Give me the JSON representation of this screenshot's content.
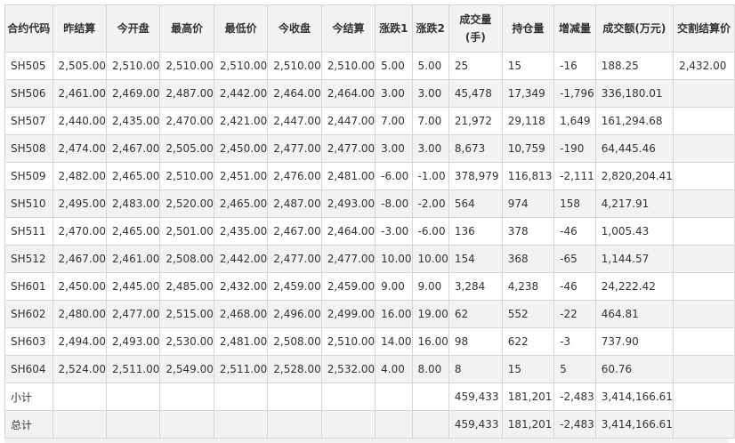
{
  "headers": [
    "合约代码",
    "昨结算",
    "今开盘",
    "最高价",
    "最低价",
    "今收盘",
    "今结算",
    "涨跌1",
    "涨跌2",
    "成交量(手)",
    "持仓量",
    "增减量",
    "成交额(万元)",
    "交割结算价"
  ],
  "rows": [
    [
      "SH505",
      "2,505.00",
      "2,510.00",
      "2,510.00",
      "2,510.00",
      "2,510.00",
      "2,510.00",
      "5.00",
      "5.00",
      "25",
      "15",
      "-16",
      "188.25",
      "2,432.00"
    ],
    [
      "SH506",
      "2,461.00",
      "2,469.00",
      "2,487.00",
      "2,442.00",
      "2,464.00",
      "2,464.00",
      "3.00",
      "3.00",
      "45,478",
      "17,349",
      "-1,796",
      "336,180.01",
      ""
    ],
    [
      "SH507",
      "2,440.00",
      "2,435.00",
      "2,470.00",
      "2,421.00",
      "2,447.00",
      "2,447.00",
      "7.00",
      "7.00",
      "21,972",
      "29,118",
      "1,649",
      "161,294.68",
      ""
    ],
    [
      "SH508",
      "2,474.00",
      "2,467.00",
      "2,505.00",
      "2,450.00",
      "2,477.00",
      "2,477.00",
      "3.00",
      "3.00",
      "8,673",
      "10,759",
      "-190",
      "64,445.46",
      ""
    ],
    [
      "SH509",
      "2,482.00",
      "2,465.00",
      "2,510.00",
      "2,451.00",
      "2,476.00",
      "2,481.00",
      "-6.00",
      "-1.00",
      "378,979",
      "116,813",
      "-2,111",
      "2,820,204.41",
      ""
    ],
    [
      "SH510",
      "2,495.00",
      "2,483.00",
      "2,520.00",
      "2,465.00",
      "2,487.00",
      "2,493.00",
      "-8.00",
      "-2.00",
      "564",
      "974",
      "158",
      "4,217.91",
      ""
    ],
    [
      "SH511",
      "2,470.00",
      "2,465.00",
      "2,501.00",
      "2,435.00",
      "2,467.00",
      "2,464.00",
      "-3.00",
      "-6.00",
      "136",
      "378",
      "-46",
      "1,005.43",
      ""
    ],
    [
      "SH512",
      "2,467.00",
      "2,461.00",
      "2,508.00",
      "2,442.00",
      "2,477.00",
      "2,477.00",
      "10.00",
      "10.00",
      "154",
      "368",
      "-65",
      "1,144.57",
      ""
    ],
    [
      "SH601",
      "2,450.00",
      "2,445.00",
      "2,485.00",
      "2,432.00",
      "2,459.00",
      "2,459.00",
      "9.00",
      "9.00",
      "3,284",
      "4,238",
      "-46",
      "24,222.42",
      ""
    ],
    [
      "SH602",
      "2,480.00",
      "2,477.00",
      "2,515.00",
      "2,468.00",
      "2,496.00",
      "2,499.00",
      "16.00",
      "19.00",
      "62",
      "552",
      "-22",
      "464.81",
      ""
    ],
    [
      "SH603",
      "2,494.00",
      "2,493.00",
      "2,530.00",
      "2,481.00",
      "2,508.00",
      "2,510.00",
      "14.00",
      "16.00",
      "98",
      "622",
      "-3",
      "737.90",
      ""
    ],
    [
      "SH604",
      "2,524.00",
      "2,511.00",
      "2,549.00",
      "2,511.00",
      "2,528.00",
      "2,532.00",
      "4.00",
      "8.00",
      "8",
      "15",
      "5",
      "60.76",
      ""
    ],
    [
      "小计",
      "",
      "",
      "",
      "",
      "",
      "",
      "",
      "",
      "459,433",
      "181,201",
      "-2,483",
      "3,414,166.61",
      ""
    ],
    [
      "总计",
      "",
      "",
      "",
      "",
      "",
      "",
      "",
      "",
      "459,433",
      "181,201",
      "-2,483",
      "3,414,166.61",
      ""
    ]
  ],
  "colors": {
    "header_bg": "#f2f2f2",
    "stripe_bg": "#f2f2f2",
    "border": "#d6d6d6",
    "text": "#333333"
  }
}
